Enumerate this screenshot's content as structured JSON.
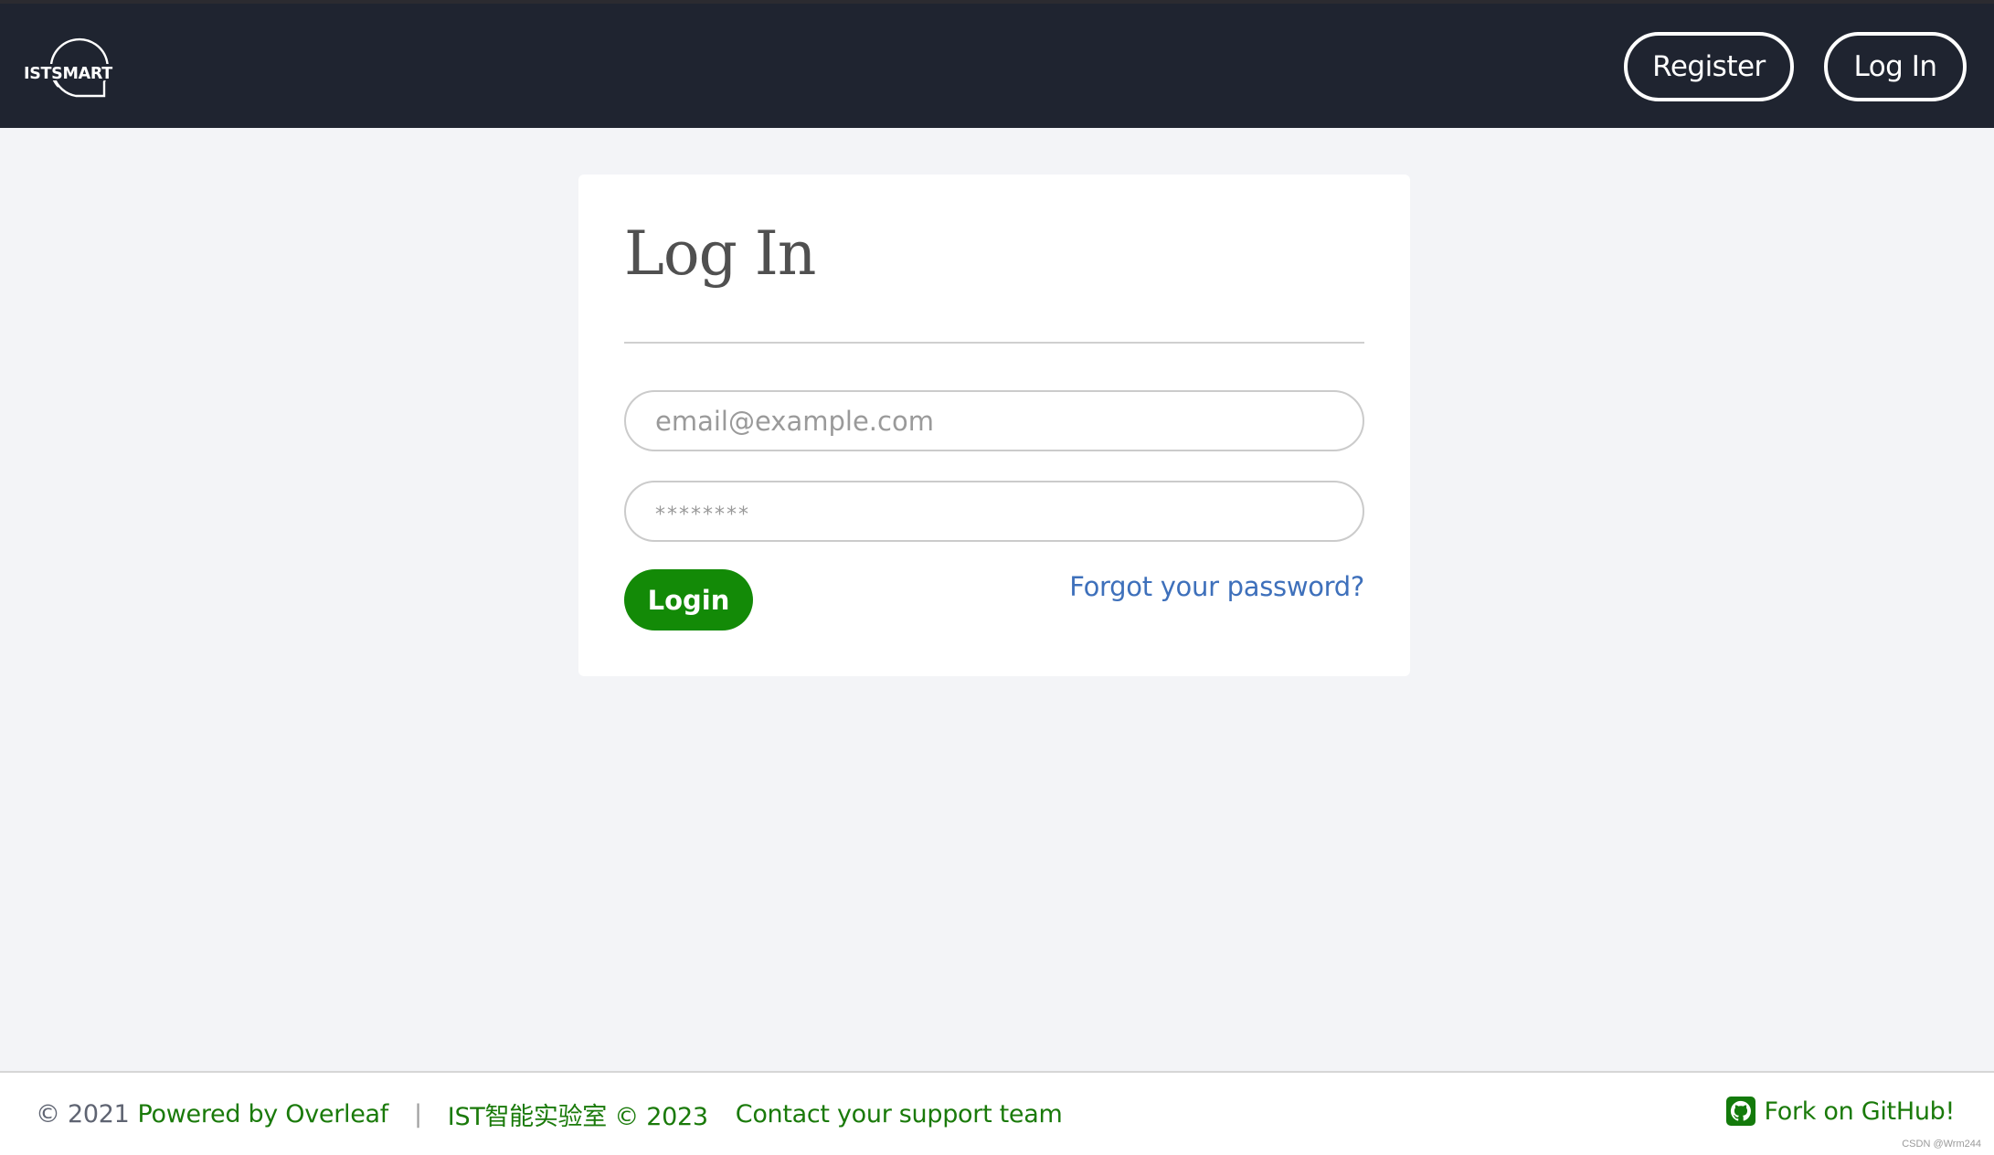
{
  "header": {
    "logo_text": "ISTSMART",
    "nav": {
      "register_label": "Register",
      "login_label": "Log In"
    }
  },
  "login_card": {
    "title": "Log In",
    "email": {
      "value": "",
      "placeholder": "email@example.com"
    },
    "password": {
      "value": "",
      "placeholder": "********"
    },
    "submit_label": "Login",
    "forgot_password_label": "Forgot your password?"
  },
  "footer": {
    "copyright_prefix": "© 2021",
    "powered_by_label": "Powered by Overleaf",
    "separator": "|",
    "lab_label": "IST智能实验室 © 2023",
    "contact_label": "Contact your support team",
    "github_label": "Fork on GitHub!",
    "github_icon": "github-icon"
  },
  "watermark": "CSDN @Wrm244",
  "colors": {
    "header_bg": "#1f2430",
    "page_bg": "#f3f4f7",
    "primary_green": "#138a07",
    "link_blue": "#3e70bb",
    "footer_link_green": "#1a7a0a"
  }
}
